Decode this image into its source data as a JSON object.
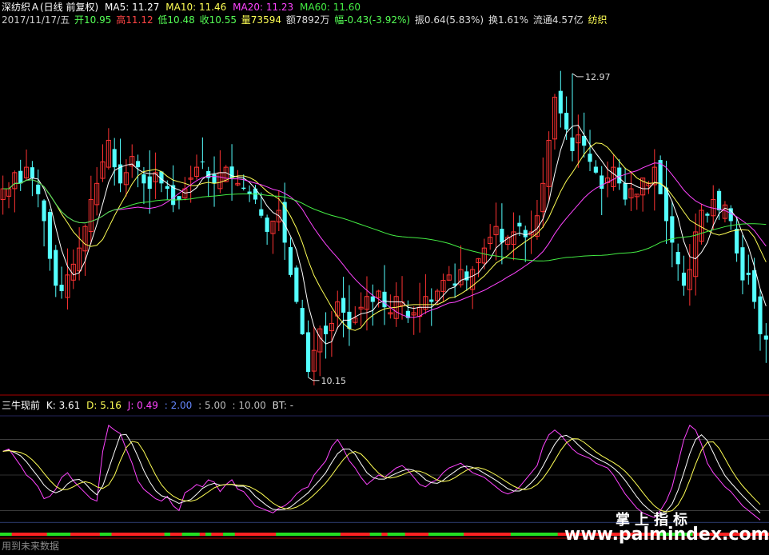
{
  "header": {
    "name": "深纺织Ａ(日线 前复权)",
    "ma5": "MA5: 11.27",
    "ma10": "MA10: 11.46",
    "ma20": "MA20: 11.23",
    "ma60": "MA60: 11.60",
    "date": "2017/11/17/五",
    "open": "开10.95",
    "high": "高11.12",
    "low": "低10.48",
    "close": "收10.55",
    "vol": "量73594",
    "amount": "额7892万",
    "chg": "幅-0.43(-3.92%)",
    "amp": "振0.64(5.83%)",
    "turnover": "换1.61%",
    "float": "流通4.57亿",
    "industry": "纺织"
  },
  "indicator": {
    "name": "三牛现前",
    "k": "K: 3.61",
    "d": "D: 5.16",
    "j": "J: 0.49",
    "l1": ": 2.00",
    "l2": ": 5.00",
    "l3": ": 10.00",
    "bt": "BT: -"
  },
  "footer": "用到未来数据",
  "watermark": {
    "line1": "掌上指标",
    "line2": "www.palmindex.com"
  },
  "chart_data": {
    "type": "candlestick",
    "annotations": {
      "high": {
        "label": "12.97",
        "value": 12.97,
        "index": 97
      },
      "low": {
        "label": "10.15",
        "value": 10.15,
        "index": 52
      }
    },
    "ylim": [
      10.0,
      13.4
    ],
    "colors": {
      "up": "#ff3333",
      "down": "#54ffff",
      "ma5": "#ffffff",
      "ma10": "#ffff55",
      "ma20": "#ff44ff",
      "ma60": "#44ee44"
    },
    "closes": [
      11.9,
      11.9,
      12.05,
      11.95,
      12.1,
      12.0,
      11.85,
      11.6,
      11.25,
      11.0,
      10.95,
      11.1,
      11.2,
      11.35,
      11.55,
      11.8,
      11.95,
      12.15,
      12.35,
      12.1,
      11.95,
      12.05,
      12.2,
      12.1,
      11.95,
      11.9,
      12.05,
      11.95,
      11.9,
      11.75,
      11.8,
      11.9,
      12.0,
      12.1,
      12.15,
      12.0,
      11.95,
      12.05,
      12.1,
      12.0,
      11.95,
      11.9,
      11.85,
      11.8,
      11.65,
      11.5,
      11.6,
      11.7,
      11.4,
      11.1,
      10.85,
      10.55,
      10.2,
      10.4,
      10.6,
      10.55,
      10.65,
      10.85,
      10.75,
      10.6,
      10.7,
      10.8,
      10.9,
      10.85,
      10.95,
      10.8,
      10.75,
      10.9,
      10.85,
      10.7,
      10.75,
      10.8,
      10.9,
      10.85,
      10.95,
      11.05,
      11.1,
      11.0,
      11.15,
      11.05,
      11.15,
      11.25,
      11.35,
      11.45,
      11.55,
      11.4,
      11.45,
      11.5,
      11.55,
      11.45,
      11.5,
      11.65,
      11.95,
      12.35,
      12.75,
      12.6,
      12.45,
      12.25,
      12.4,
      12.3,
      12.15,
      12.05,
      11.9,
      12.0,
      12.1,
      11.95,
      11.8,
      11.9,
      11.85,
      12.0,
      11.95,
      12.1,
      11.85,
      11.6,
      11.4,
      11.2,
      11.0,
      11.15,
      11.5,
      11.7,
      11.65,
      11.8,
      11.7,
      11.75,
      11.6,
      11.3,
      11.05,
      11.1,
      10.85,
      10.55,
      10.5
    ],
    "kdj_j": [
      70,
      72,
      65,
      58,
      50,
      46,
      40,
      30,
      32,
      38,
      48,
      52,
      45,
      40,
      35,
      30,
      28,
      70,
      92,
      88,
      85,
      72,
      60,
      45,
      38,
      34,
      30,
      28,
      32,
      24,
      20,
      35,
      38,
      42,
      40,
      46,
      44,
      36,
      42,
      46,
      38,
      36,
      30,
      24,
      22,
      20,
      18,
      22,
      24,
      28,
      34,
      38,
      40,
      50,
      56,
      62,
      74,
      80,
      72,
      62,
      56,
      48,
      42,
      46,
      50,
      48,
      52,
      56,
      58,
      54,
      48,
      42,
      40,
      44,
      46,
      52,
      56,
      58,
      60,
      56,
      52,
      50,
      48,
      44,
      40,
      36,
      34,
      36,
      40,
      46,
      52,
      58,
      74,
      84,
      88,
      84,
      78,
      72,
      68,
      66,
      64,
      60,
      58,
      56,
      50,
      42,
      34,
      28,
      22,
      18,
      16,
      14,
      20,
      28,
      40,
      60,
      80,
      92,
      88,
      76,
      60,
      52,
      46,
      40,
      36,
      30,
      24,
      20,
      16,
      12
    ]
  }
}
